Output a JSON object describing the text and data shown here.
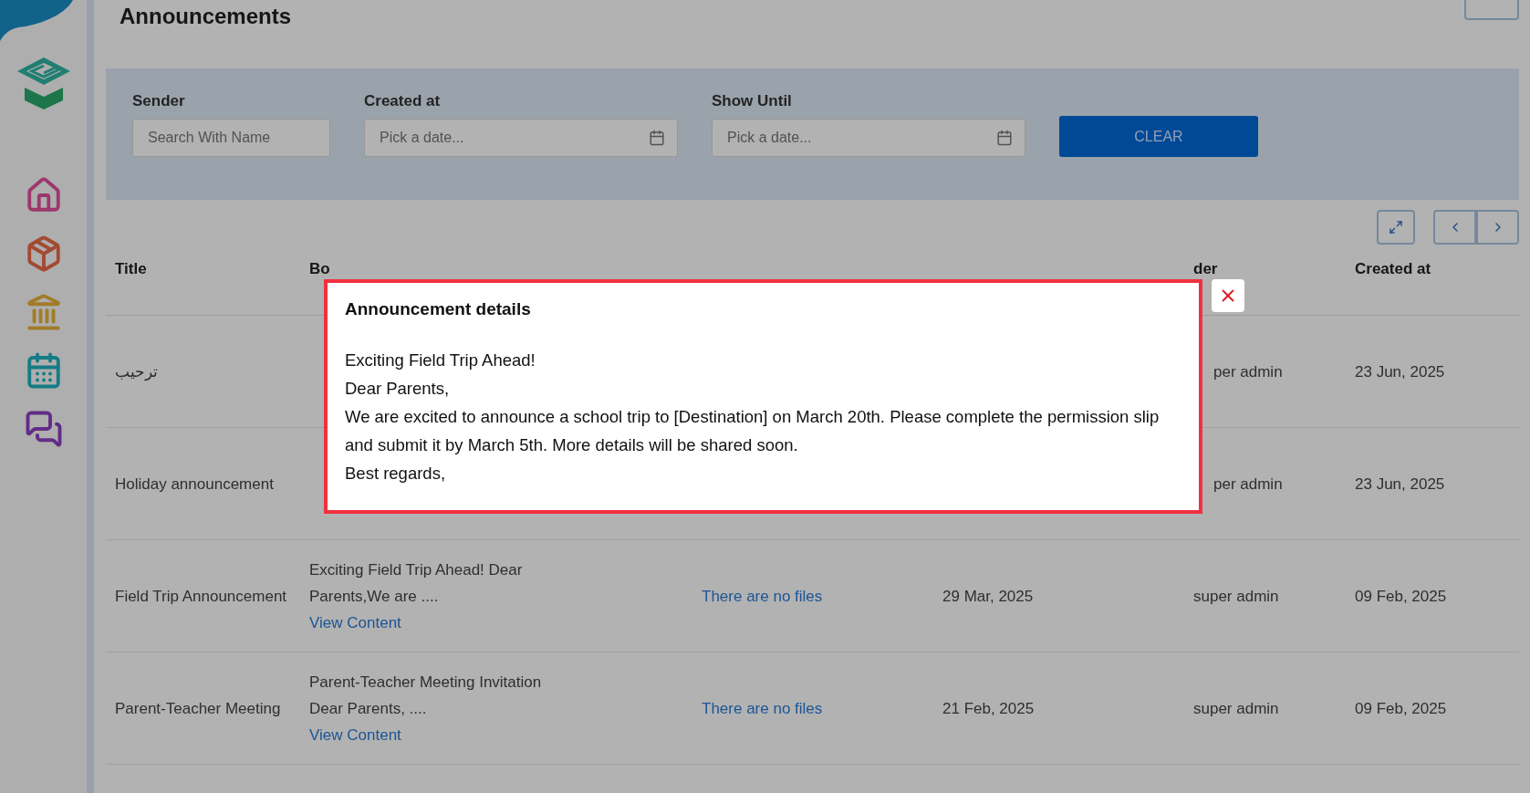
{
  "page": {
    "title": "Announcements"
  },
  "sidebar": {
    "items": [
      {
        "kind": "home"
      },
      {
        "kind": "box"
      },
      {
        "kind": "bank"
      },
      {
        "kind": "calendar"
      },
      {
        "kind": "chat"
      }
    ]
  },
  "filters": {
    "fields": [
      {
        "label": "Sender",
        "placeholder": "Search With Name",
        "kind": "text"
      },
      {
        "label": "Created at",
        "placeholder": "Pick a date...",
        "kind": "date"
      },
      {
        "label": "Show Until",
        "placeholder": "Pick a date...",
        "kind": "date"
      }
    ],
    "clear_button": "CLEAR"
  },
  "table": {
    "columns": [
      {
        "label": "Title"
      },
      {
        "label": "Bo"
      },
      {},
      {},
      {
        "label": "der"
      },
      {
        "label": "Created at"
      }
    ],
    "rows": [
      {
        "title": "ترحيب",
        "sender": "per admin",
        "created_at": "23 Jun, 2025"
      },
      {
        "title": "Holiday announcement",
        "sender": "per admin",
        "created_at": "23 Jun, 2025"
      },
      {
        "title": "Field Trip Announcement",
        "body": "Exciting Field Trip Ahead! Dear Parents,We are ....",
        "link": "View Content",
        "files": "There are no files",
        "show_until": "29 Mar, 2025",
        "sender": "super admin",
        "created_at": "09 Feb, 2025"
      },
      {
        "title": "Parent-Teacher Meeting",
        "body": "Parent-Teacher Meeting Invitation Dear Parents, ....",
        "link": "View Content",
        "files": "There are no files",
        "show_until": "21 Feb, 2025",
        "sender": "super admin",
        "created_at": "09 Feb, 2025"
      },
      {}
    ]
  },
  "dialog": {
    "title": "Announcement details",
    "lines": [
      "Exciting Field Trip Ahead!",
      "Dear Parents,",
      "We are excited to announce a school trip to [Destination] on March 20th. Please complete the permission slip and submit it by March 5th. More details will be shared soon.",
      "Best regards,"
    ]
  }
}
